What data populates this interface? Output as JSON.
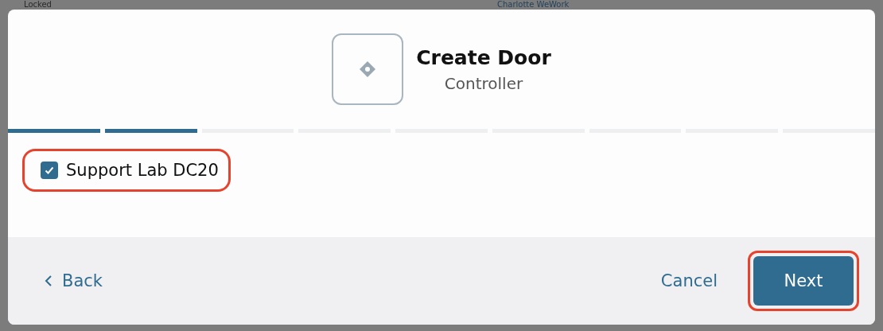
{
  "background": {
    "texts": [
      "Locked",
      "Charlotte WeWork"
    ]
  },
  "dialog": {
    "title": "Create Door",
    "subtitle": "Controller",
    "steps": [
      {
        "done": true
      },
      {
        "done": true
      },
      {
        "done": false
      },
      {
        "done": false
      },
      {
        "done": false
      },
      {
        "done": false
      },
      {
        "done": false
      },
      {
        "done": false
      },
      {
        "done": false
      }
    ],
    "options": [
      {
        "label": "Support Lab DC20",
        "checked": true,
        "highlighted": true
      }
    ],
    "footer": {
      "back": "Back",
      "cancel": "Cancel",
      "next": {
        "label": "Next",
        "highlighted": true
      }
    }
  }
}
